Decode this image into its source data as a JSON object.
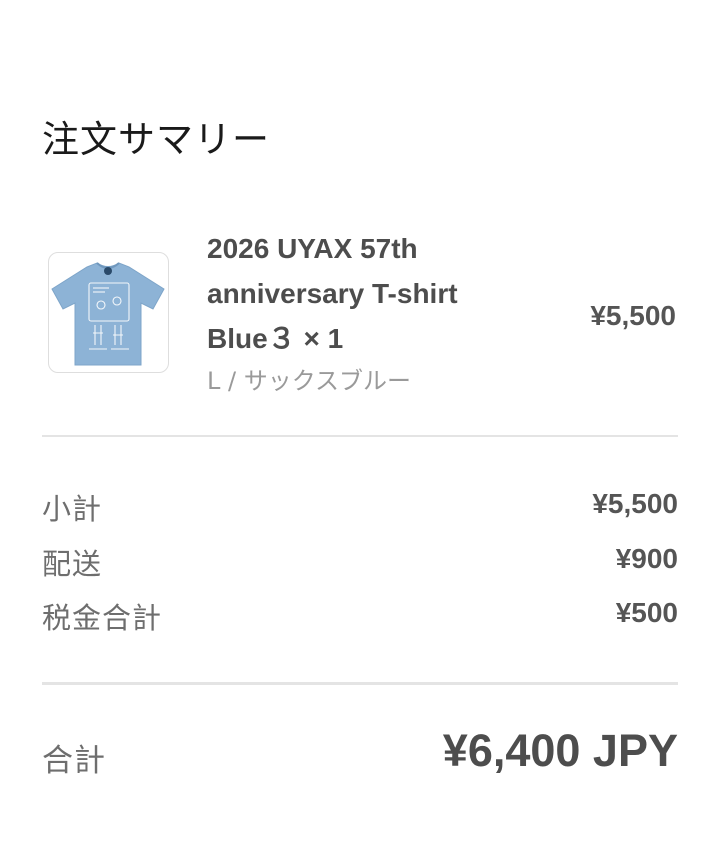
{
  "summary": {
    "title": "注文サマリー"
  },
  "item": {
    "image_icon": "t-shirt-icon",
    "shirt_color": "#8db3d6",
    "name_line1": "2026 UYAX 57th",
    "name_line2": "anniversary T-shirt",
    "name_line3": "Blue３ × 1",
    "variant": "L / サックスブルー",
    "price": "¥5,500"
  },
  "breakdown": {
    "subtotal_label": "小計",
    "subtotal_value": "¥5,500",
    "shipping_label": "配送",
    "shipping_value": "¥900",
    "tax_label": "税金合計",
    "tax_value": "¥500"
  },
  "total": {
    "label": "合計",
    "value": "¥6,400 JPY"
  }
}
